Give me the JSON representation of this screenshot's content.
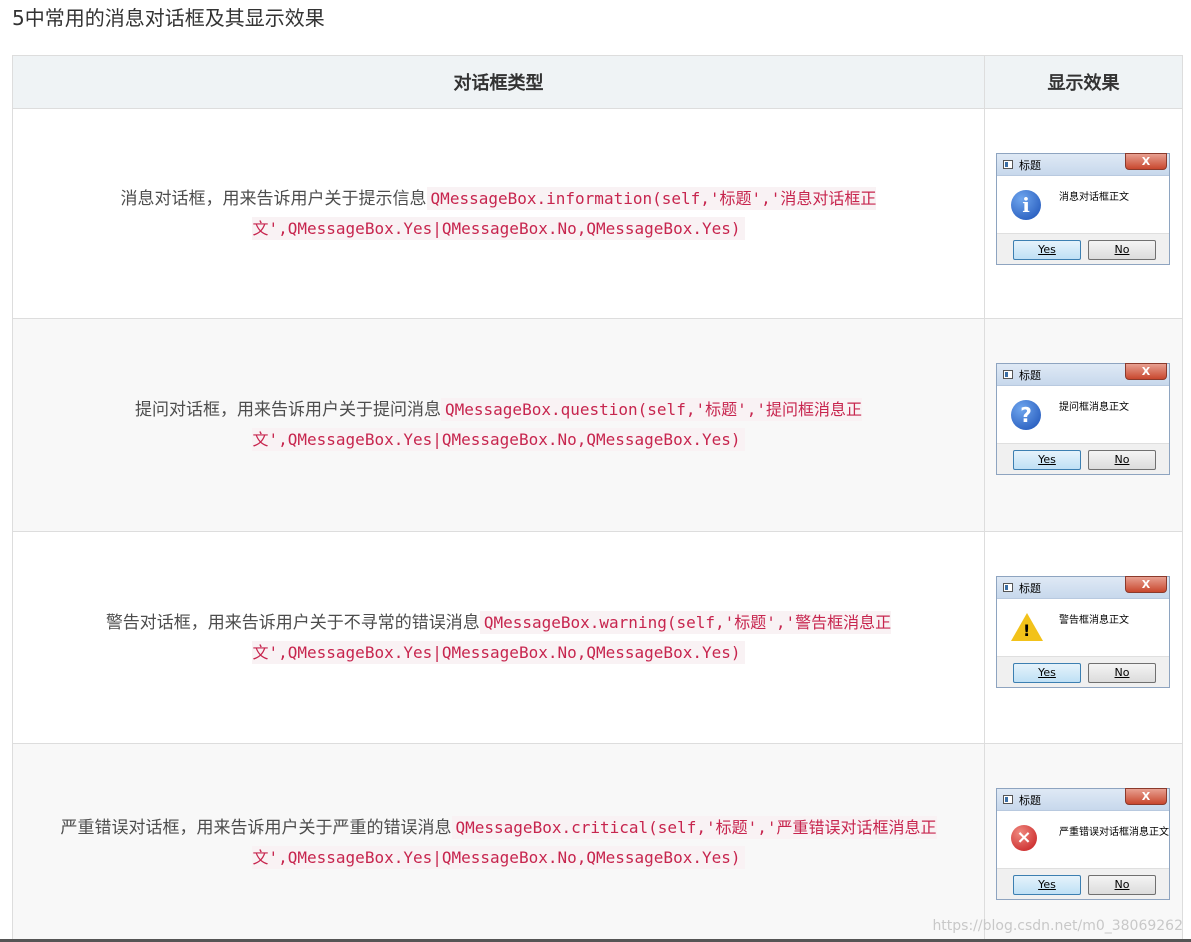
{
  "section_title": "5中常用的消息对话框及其显示效果",
  "table": {
    "headers": [
      "对话框类型",
      "显示效果"
    ],
    "rows": [
      {
        "desc": "消息对话框，用来告诉用户关于提示信息",
        "code": "QMessageBox.information(self,'标题','消息对话框正文',QMessageBox.Yes|QMessageBox.No,QMessageBox.Yes)",
        "box": {
          "title": "标题",
          "close": "X",
          "icon": "information-icon",
          "message": "消息对话框正文",
          "yes": "Yes",
          "no": "No"
        }
      },
      {
        "desc": "提问对话框，用来告诉用户关于提问消息",
        "code": "QMessageBox.question(self,'标题','提问框消息正文',QMessageBox.Yes|QMessageBox.No,QMessageBox.Yes)",
        "box": {
          "title": "标题",
          "close": "X",
          "icon": "question-icon",
          "message": "提问框消息正文",
          "yes": "Yes",
          "no": "No"
        }
      },
      {
        "desc": "警告对话框，用来告诉用户关于不寻常的错误消息",
        "code": "QMessageBox.warning(self,'标题','警告框消息正文',QMessageBox.Yes|QMessageBox.No,QMessageBox.Yes)",
        "box": {
          "title": "标题",
          "close": "X",
          "icon": "warning-icon",
          "message": "警告框消息正文",
          "yes": "Yes",
          "no": "No"
        }
      },
      {
        "desc": "严重错误对话框，用来告诉用户关于严重的错误消息",
        "code": "QMessageBox.critical(self,'标题','严重错误对话框消息正文',QMessageBox.Yes|QMessageBox.No,QMessageBox.Yes)",
        "box": {
          "title": "标题",
          "close": "X",
          "icon": "critical-icon",
          "message": "严重错误对话框消息正文",
          "yes": "Yes",
          "no": "No"
        }
      }
    ]
  },
  "watermark": "https://blog.csdn.net/m0_38069262"
}
